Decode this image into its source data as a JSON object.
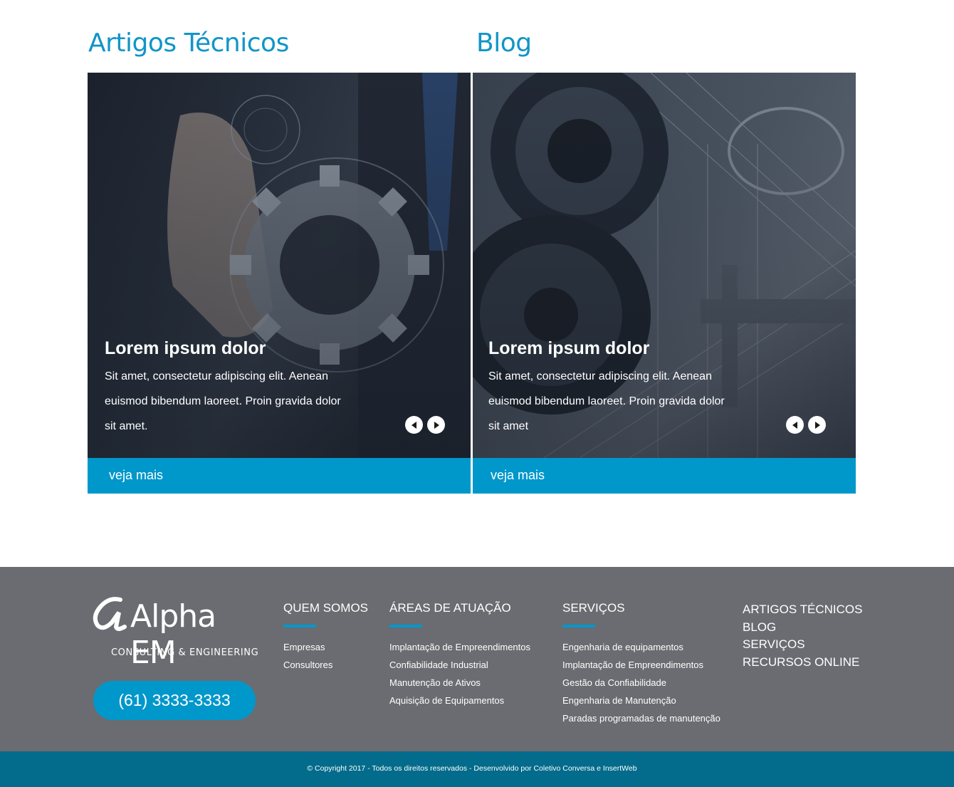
{
  "sections": {
    "artigos_title": "Artigos Técnicos",
    "blog_title": "Blog"
  },
  "cards": {
    "artigos": {
      "heading": "Lorem ipsum dolor",
      "text": "Sit amet, consectetur adipiscing elit. Aenean euismod bibendum laoreet. Proin gravida dolor sit amet.",
      "cta": "veja mais"
    },
    "blog": {
      "heading": "Lorem ipsum dolor",
      "text": "Sit amet, consectetur adipiscing elit. Aenean euismod bibendum laoreet. Proin gravida dolor sit amet",
      "cta": "veja mais"
    }
  },
  "footer": {
    "logo_word": "Alpha EM",
    "logo_tagline": "CONSULTING & ENGINEERING",
    "phone": "(61) 3333-3333",
    "quem_somos": {
      "title": "QUEM SOMOS",
      "items": [
        "Empresas",
        "Consultores"
      ]
    },
    "areas": {
      "title": "ÁREAS DE ATUAÇÃO",
      "items": [
        "Implantação de Empreendimentos",
        "Confiabilidade Industrial",
        "Manutenção de Ativos",
        "Aquisição de Equipamentos"
      ]
    },
    "servicos": {
      "title": "SERVIÇOS",
      "items": [
        "Engenharia de equipamentos",
        "Implantação de Empreendimentos",
        "Gestão da Confiabilidade",
        "Engenharia de Manutenção",
        "Paradas programadas de manutenção"
      ]
    },
    "links": [
      "ARTIGOS TÉCNICOS",
      "BLOG",
      "SERVIÇOS",
      "RECURSOS ONLINE"
    ],
    "copyright": "© Copyright 2017 - Todos os direitos reservados - Desenvolvido por Coletivo Conversa e InsertWeb"
  },
  "icons": {
    "prev": "arrow-left-icon",
    "next": "arrow-right-icon",
    "alpha": "alpha-logo-icon"
  },
  "colors": {
    "accent": "#0097cb",
    "title": "#1195c8",
    "footer_bg": "#6b6c71",
    "copyright_bg": "#036b8b"
  }
}
